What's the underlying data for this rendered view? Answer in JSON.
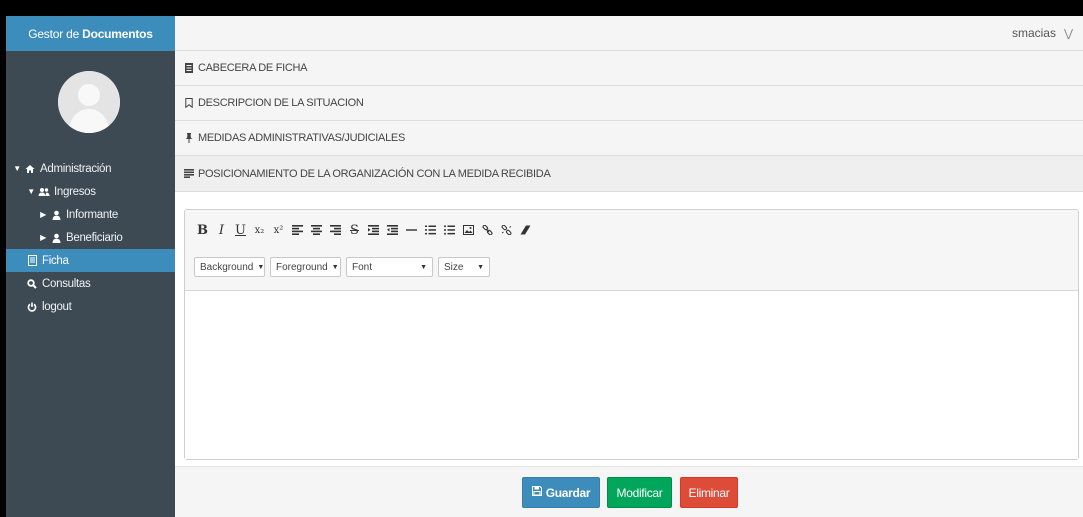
{
  "brand": {
    "prefix": "Gestor de",
    "strong": "Documentos"
  },
  "user": {
    "name": "smacias",
    "menu_icon": "chevron-down-icon"
  },
  "sidebar": {
    "items": [
      {
        "label": "Administración",
        "icon": "home-icon",
        "caret": "caret-down"
      },
      {
        "label": "Ingresos",
        "icon": "users-icon",
        "caret": "caret-down"
      },
      {
        "label": "Informante",
        "icon": "user-icon",
        "caret": "caret-right"
      },
      {
        "label": "Beneficiario",
        "icon": "user-icon",
        "caret": "caret-right"
      },
      {
        "label": "Ficha",
        "icon": "file-icon",
        "active": true
      },
      {
        "label": "Consultas",
        "icon": "search-icon"
      },
      {
        "label": "logout",
        "icon": "power-icon"
      }
    ]
  },
  "panels": [
    {
      "label": "CABECERA DE FICHA",
      "icon": "file-icon"
    },
    {
      "label": "DESCRIPCION DE LA SITUACION",
      "icon": "bookmark-icon"
    },
    {
      "label": "MEDIDAS ADMINISTRATIVAS/JUDICIALES",
      "icon": "pin-icon"
    },
    {
      "label": "POSICIONAMIENTO DE LA ORGANIZACIÓN CON LA MEDIDA RECIBIDA",
      "icon": "list-icon"
    }
  ],
  "editor": {
    "toolbar": {
      "dropdowns": [
        {
          "label": "Background"
        },
        {
          "label": "Foreground"
        },
        {
          "label": "Font"
        },
        {
          "label": "Size"
        }
      ]
    },
    "content": ""
  },
  "actions": {
    "save": "Guardar",
    "modify": "Modificar",
    "delete": "Eliminar"
  },
  "colors": {
    "sidebar": "#3d4a54",
    "primary": "#3c8dbc",
    "success": "#00a65a",
    "danger": "#dd4b39"
  }
}
